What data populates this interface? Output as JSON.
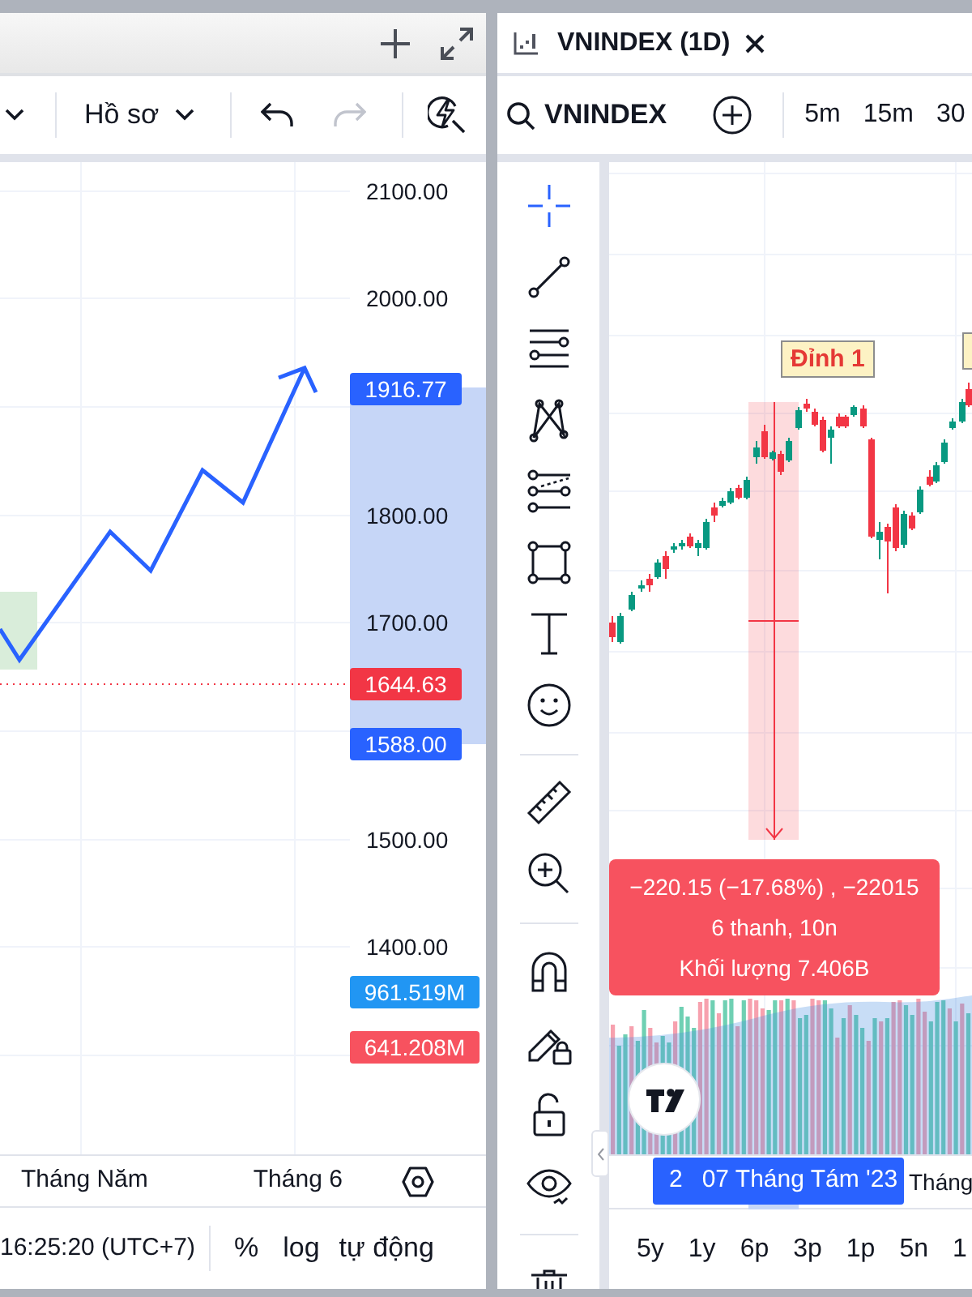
{
  "left_panel": {
    "toolbar": {
      "profile_menu": "Hồ sơ",
      "undo": {
        "disabled": false
      },
      "redo": {
        "disabled": true
      }
    },
    "price_axis": {
      "labels": [
        "2100.00",
        "2000.00",
        "1800.00",
        "1700.00",
        "1500.00",
        "1400.00"
      ],
      "markers": [
        {
          "text": "1916.77",
          "color": "#2962ff"
        },
        {
          "text": "1644.63",
          "color": "#f23645"
        },
        {
          "text": "1588.00",
          "color": "#2962ff"
        },
        {
          "text": "961.519M",
          "color": "#2196f3"
        },
        {
          "text": "641.208M",
          "color": "#f7525f"
        }
      ]
    },
    "time_axis": {
      "labels": [
        "Tháng Năm",
        "Tháng 6"
      ]
    },
    "status_bar": {
      "time": "16:25:20 (UTC+7)",
      "options": [
        "%",
        "log",
        "tự động"
      ]
    }
  },
  "right_panel": {
    "tab": {
      "title": "VNINDEX (1D)"
    },
    "toolbar": {
      "symbol": "VNINDEX",
      "intervals": [
        "5m",
        "15m",
        "30"
      ]
    },
    "drawing_tool_groups": [
      {
        "tools": [
          {
            "kind": "crosshair",
            "selected": true
          },
          {
            "kind": "trend_line",
            "selected": false
          },
          {
            "kind": "parallel_lines",
            "selected": false
          },
          {
            "kind": "pattern",
            "selected": false
          },
          {
            "kind": "node_lines",
            "selected": false
          },
          {
            "kind": "rectangle",
            "selected": false
          },
          {
            "kind": "text",
            "selected": false
          },
          {
            "kind": "emoji",
            "selected": false
          }
        ]
      },
      {
        "tools": [
          {
            "kind": "ruler",
            "selected": false
          },
          {
            "kind": "zoom_in",
            "selected": false
          }
        ]
      },
      {
        "tools": [
          {
            "kind": "magnet",
            "selected": false
          },
          {
            "kind": "pencil_lock",
            "selected": false
          },
          {
            "kind": "unlock",
            "selected": false
          },
          {
            "kind": "eye",
            "selected": false
          }
        ]
      },
      {
        "tools": [
          {
            "kind": "trash",
            "selected": false
          }
        ]
      }
    ],
    "chart": {
      "labels": [
        "Đỉnh 1"
      ],
      "measure_tooltip": [
        "−220.15 (−17.68%) , −22015",
        "6 thanh, 10n",
        "Khối lượng 7.406B"
      ],
      "time_axis": {
        "cursor_label": [
          "2",
          "07 Tháng Tám '23"
        ],
        "labels": [
          "Tháng"
        ]
      }
    },
    "date_ranges": [
      "5y",
      "1y",
      "6p",
      "3p",
      "1p",
      "5n",
      "1"
    ]
  }
}
